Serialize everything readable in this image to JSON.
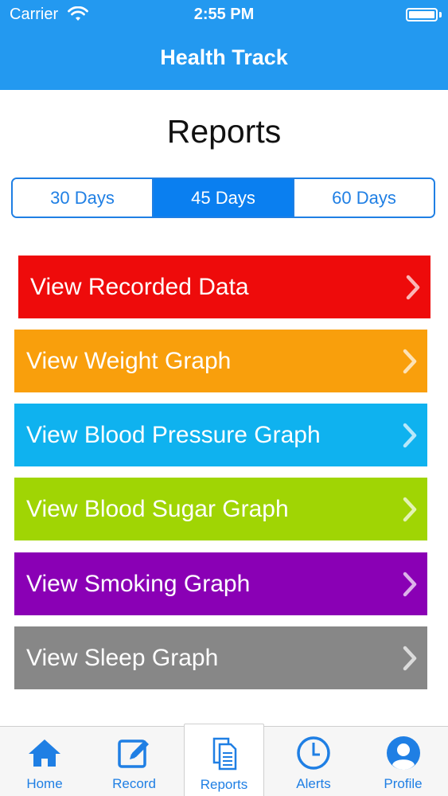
{
  "status_bar": {
    "carrier": "Carrier",
    "time": "2:55 PM"
  },
  "header": {
    "title": "Health Track",
    "background": "#2399f0"
  },
  "page": {
    "heading": "Reports"
  },
  "range_selector": {
    "options": [
      "30 Days",
      "45 Days",
      "60 Days"
    ],
    "selected": "45 Days",
    "accent": "#0a7ff0"
  },
  "report_buttons": [
    {
      "label": "View Recorded Data",
      "color": "#ee0b0b"
    },
    {
      "label": "View Weight Graph",
      "color": "#f99f0c"
    },
    {
      "label": "View Blood Pressure Graph",
      "color": "#0fb2ef"
    },
    {
      "label": "View Blood Sugar Graph",
      "color": "#a0d504"
    },
    {
      "label": "View Smoking Graph",
      "color": "#8a00b5"
    },
    {
      "label": "View Sleep Graph",
      "color": "#878787"
    }
  ],
  "tab_bar": {
    "items": [
      {
        "label": "Home",
        "icon": "home-icon"
      },
      {
        "label": "Record",
        "icon": "edit-icon"
      },
      {
        "label": "Reports",
        "icon": "documents-icon"
      },
      {
        "label": "Alerts",
        "icon": "clock-icon"
      },
      {
        "label": "Profile",
        "icon": "user-icon"
      }
    ],
    "active": "Reports"
  }
}
